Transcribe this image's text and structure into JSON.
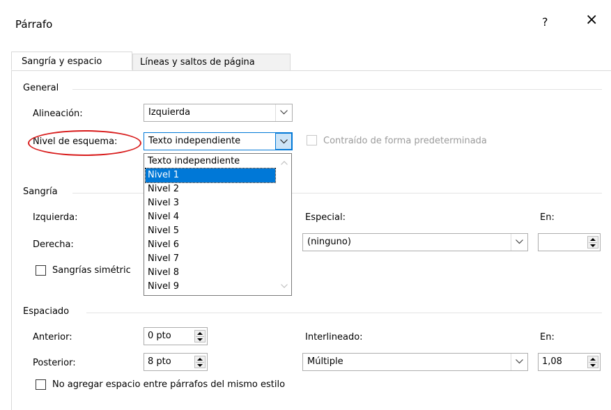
{
  "dialog": {
    "title": "Párrafo",
    "help": "?",
    "close": "×"
  },
  "tabs": [
    {
      "label": "Sangría y espacio",
      "active": true
    },
    {
      "label": "Líneas y saltos de página",
      "active": false
    }
  ],
  "general": {
    "section": "General",
    "alignment_label": "Alineación:",
    "alignment_value": "Izquierda",
    "outline_label": "Nivel de esquema:",
    "outline_value": "Texto independiente",
    "collapsed_label": "Contraído de forma predeterminada",
    "outline_options": [
      "Texto independiente",
      "Nivel 1",
      "Nivel 2",
      "Nivel 3",
      "Nivel 4",
      "Nivel 5",
      "Nivel 6",
      "Nivel 7",
      "Nivel 8",
      "Nivel 9"
    ],
    "highlighted_option": "Nivel 1"
  },
  "indent": {
    "section": "Sangría",
    "left_label": "Izquierda:",
    "right_label": "Derecha:",
    "mirror_label": "Sangrías simétric",
    "special_label": "Especial:",
    "special_value": "(ninguno)",
    "by_label": "En:",
    "by_value": ""
  },
  "spacing": {
    "section": "Espaciado",
    "before_label": "Anterior:",
    "before_value": "0 pto",
    "after_label": "Posterior:",
    "after_value": "8 pto",
    "line_label": "Interlineado:",
    "line_value": "Múltiple",
    "at_label": "En:",
    "at_value": "1,08",
    "no_space_label": "No agregar espacio entre párrafos del mismo estilo"
  },
  "colors": {
    "accent": "#0078d7",
    "highlight_ellipse": "#d81b1b"
  },
  "icons": [
    "help-icon",
    "close-icon",
    "chevron-down-icon",
    "spin-up-icon",
    "spin-down-icon",
    "scroll-up-icon",
    "scroll-down-icon"
  ]
}
